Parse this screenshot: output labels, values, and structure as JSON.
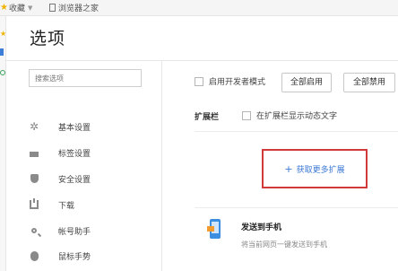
{
  "bookmarks": {
    "favorites_label": "收藏",
    "page_label": "浏览器之家"
  },
  "page": {
    "title": "选项"
  },
  "sidebar": {
    "search_placeholder": "搜索选项",
    "items": [
      {
        "label": "基本设置",
        "icon": "gear-icon"
      },
      {
        "label": "标签设置",
        "icon": "tab-icon"
      },
      {
        "label": "安全设置",
        "icon": "shield-icon"
      },
      {
        "label": "下载",
        "icon": "download-icon"
      },
      {
        "label": "帐号助手",
        "icon": "key-icon"
      },
      {
        "label": "鼠标手势",
        "icon": "mouse-icon"
      }
    ]
  },
  "main": {
    "dev_mode_label": "启用开发者模式",
    "enable_all_label": "全部启用",
    "disable_all_label": "全部禁用",
    "ext_bar_label": "扩展栏",
    "show_dynamic_text_label": "在扩展栏显示动态文字",
    "get_more_label": "获取更多扩展",
    "extension": {
      "title": "发送到手机",
      "description": "将当前网页一键发送到手机",
      "icon": "phone-icon"
    }
  }
}
